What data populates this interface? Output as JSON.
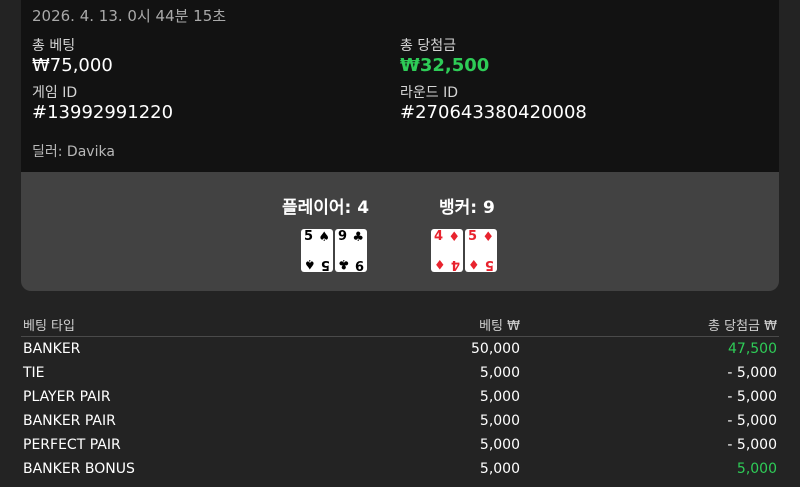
{
  "summary": {
    "datetime": "2026. 4. 13. 0시 44분 15초",
    "total_bet_label": "총 베팅",
    "total_bet_value": "₩75,000",
    "total_win_label": "총 당첨금",
    "total_win_value": "₩32,500",
    "game_id_label": "게임 ID",
    "game_id_value": "#13992991220",
    "round_id_label": "라운드 ID",
    "round_id_value": "#270643380420008",
    "dealer": "딜러: Davika"
  },
  "result": {
    "player_label": "플레이어: 4",
    "banker_label": "뱅커: 9",
    "player_cards": [
      {
        "rank": "5",
        "suit": "♠",
        "color": "black"
      },
      {
        "rank": "9",
        "suit": "♣",
        "color": "black"
      }
    ],
    "banker_cards": [
      {
        "rank": "4",
        "suit": "♦",
        "color": "red"
      },
      {
        "rank": "5",
        "suit": "♦",
        "color": "red"
      }
    ]
  },
  "bets": {
    "headers": {
      "type": "베팅 타입",
      "bet": "베팅 ₩",
      "win": "총 당첨금 ₩"
    },
    "rows": [
      {
        "type": "BANKER",
        "bet": "50,000",
        "win": "47,500",
        "positive": true
      },
      {
        "type": "TIE",
        "bet": "5,000",
        "win": "- 5,000",
        "positive": false
      },
      {
        "type": "PLAYER PAIR",
        "bet": "5,000",
        "win": "- 5,000",
        "positive": false
      },
      {
        "type": "BANKER PAIR",
        "bet": "5,000",
        "win": "- 5,000",
        "positive": false
      },
      {
        "type": "PERFECT PAIR",
        "bet": "5,000",
        "win": "- 5,000",
        "positive": false
      },
      {
        "type": "BANKER BONUS",
        "bet": "5,000",
        "win": "5,000",
        "positive": true
      }
    ]
  },
  "colors": {
    "win": "#2ecc57",
    "red_suit": "#e8232e",
    "panel": "#424242",
    "card_bg": "#121212",
    "page_bg": "#232323"
  }
}
